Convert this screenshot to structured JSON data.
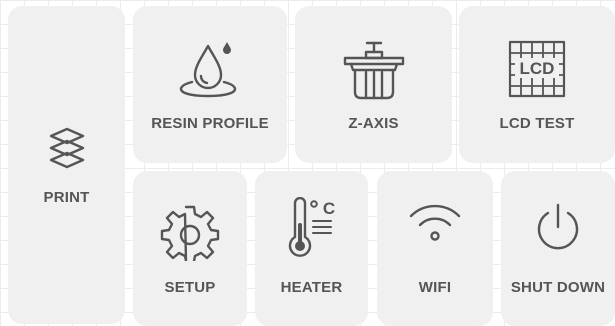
{
  "tiles": {
    "print": {
      "label": "PRINT",
      "icon": "layers-icon"
    },
    "resin_profile": {
      "label": "RESIN PROFILE",
      "icon": "resin-drop-icon"
    },
    "z_axis": {
      "label": "Z-AXIS",
      "icon": "z-axis-platform-icon"
    },
    "lcd_test": {
      "label": "LCD TEST",
      "icon": "lcd-grid-icon"
    },
    "setup": {
      "label": "SETUP",
      "icon": "gear-icon"
    },
    "heater": {
      "label": "HEATER",
      "icon": "thermometer-celsius-icon",
      "unit_symbol": "℃"
    },
    "wifi": {
      "label": "WIFI",
      "icon": "wifi-icon"
    },
    "shut_down": {
      "label": "SHUT DOWN",
      "icon": "power-icon"
    }
  },
  "lcd_icon_text": "LCD",
  "colors": {
    "tile_background": "#f0f0f0",
    "foreground": "#555555",
    "page_background": "#ffffff",
    "grid_lines": "#ececec"
  }
}
